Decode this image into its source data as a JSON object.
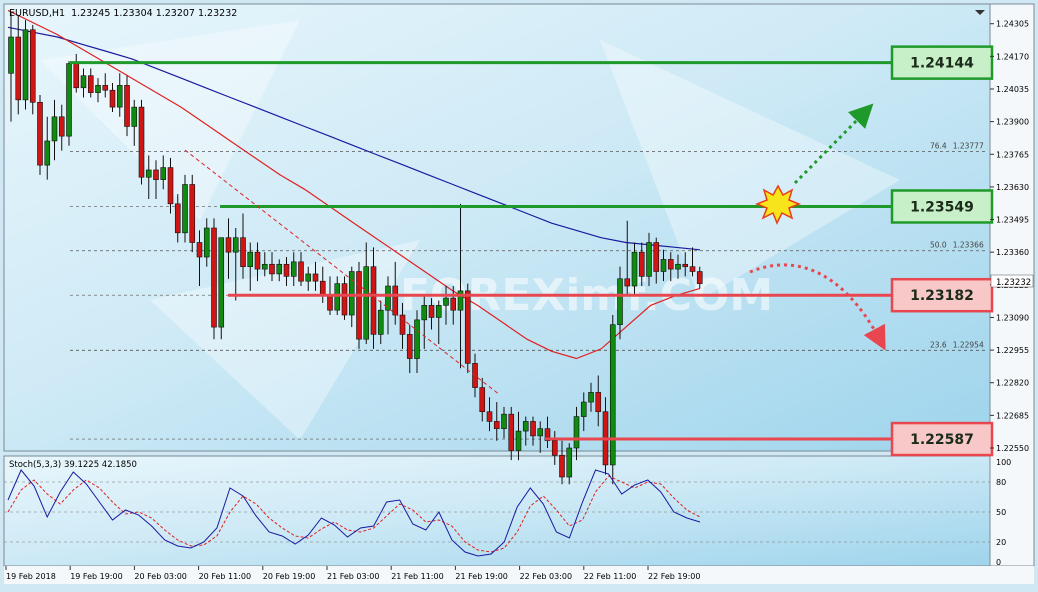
{
  "chart_title": {
    "symbol": "EURUSD,H1",
    "ohlc": "1.23245 1.23304 1.23207 1.23232"
  },
  "watermark": "FOREXimf.COM",
  "price_axis": {
    "ticks": [
      "1.24305",
      "1.24170",
      "1.24035",
      "1.23900",
      "1.23765",
      "1.23630",
      "1.23495",
      "1.23360",
      "1.23225",
      "1.23090",
      "1.22955",
      "1.22820",
      "1.22685",
      "1.22550"
    ],
    "current_price": "1.23232"
  },
  "time_axis": {
    "labels": [
      "19 Feb 2018",
      "19 Feb 19:00",
      "20 Feb 03:00",
      "20 Feb 11:00",
      "20 Feb 19:00",
      "21 Feb 03:00",
      "21 Feb 11:00",
      "21 Feb 19:00",
      "22 Feb 03:00",
      "22 Feb 11:00",
      "22 Feb 19:00"
    ]
  },
  "levels": [
    {
      "value": 1.24144,
      "label": "1.24144",
      "kind": "resistance",
      "color": "#1f9a2a",
      "fill": "#c8f0c8"
    },
    {
      "value": 1.23549,
      "label": "1.23549",
      "kind": "resistance",
      "color": "#1f9a2a",
      "fill": "#c8f0c8"
    },
    {
      "value": 1.23182,
      "label": "1.23182",
      "kind": "support",
      "color": "#e8474f",
      "fill": "#f8c8c8"
    },
    {
      "value": 1.22587,
      "label": "1.22587",
      "kind": "support",
      "color": "#e8474f",
      "fill": "#f8c8c8"
    }
  ],
  "fibonacci": [
    {
      "ratio": "76.4",
      "price": "1.23777"
    },
    {
      "ratio": "50.0",
      "price": "1.23366"
    },
    {
      "ratio": "23.6",
      "price": "1.22954"
    }
  ],
  "stochastic": {
    "title": "Stoch(5,3,3) 39.1225 42.1850",
    "ticks": [
      "100",
      "80",
      "50",
      "20",
      "0"
    ]
  },
  "colors": {
    "bull_candle": "#118a11",
    "bear_candle": "#d01515",
    "ma_fast": "#e02020",
    "ma_slow": "#1a1aa0"
  },
  "chart_data": {
    "type": "candlestick",
    "symbol": "EURUSD",
    "timeframe": "H1",
    "ylim": [
      1.2255,
      1.2437
    ],
    "candles": [
      {
        "o": 1.241,
        "h": 1.2435,
        "l": 1.239,
        "c": 1.2425
      },
      {
        "o": 1.2425,
        "h": 1.2434,
        "l": 1.2393,
        "c": 1.2399
      },
      {
        "o": 1.2399,
        "h": 1.2432,
        "l": 1.2395,
        "c": 1.2428
      },
      {
        "o": 1.2428,
        "h": 1.243,
        "l": 1.2393,
        "c": 1.2398
      },
      {
        "o": 1.2398,
        "h": 1.2401,
        "l": 1.2368,
        "c": 1.2372
      },
      {
        "o": 1.2372,
        "h": 1.2392,
        "l": 1.2366,
        "c": 1.2382
      },
      {
        "o": 1.2382,
        "h": 1.2399,
        "l": 1.2374,
        "c": 1.2392
      },
      {
        "o": 1.2392,
        "h": 1.2397,
        "l": 1.2378,
        "c": 1.2384
      },
      {
        "o": 1.2384,
        "h": 1.2415,
        "l": 1.238,
        "c": 1.2414
      },
      {
        "o": 1.2414,
        "h": 1.2418,
        "l": 1.2402,
        "c": 1.2404
      },
      {
        "o": 1.2404,
        "h": 1.2412,
        "l": 1.24,
        "c": 1.2409
      },
      {
        "o": 1.2409,
        "h": 1.2412,
        "l": 1.24,
        "c": 1.2402
      },
      {
        "o": 1.2402,
        "h": 1.2408,
        "l": 1.2398,
        "c": 1.2405
      },
      {
        "o": 1.2405,
        "h": 1.241,
        "l": 1.24,
        "c": 1.2403
      },
      {
        "o": 1.2403,
        "h": 1.2406,
        "l": 1.2394,
        "c": 1.2396
      },
      {
        "o": 1.2396,
        "h": 1.241,
        "l": 1.2392,
        "c": 1.2405
      },
      {
        "o": 1.2405,
        "h": 1.2409,
        "l": 1.2384,
        "c": 1.2388
      },
      {
        "o": 1.2388,
        "h": 1.2399,
        "l": 1.238,
        "c": 1.2396
      },
      {
        "o": 1.2396,
        "h": 1.2399,
        "l": 1.2364,
        "c": 1.2367
      },
      {
        "o": 1.2367,
        "h": 1.2376,
        "l": 1.2358,
        "c": 1.237
      },
      {
        "o": 1.237,
        "h": 1.2374,
        "l": 1.2358,
        "c": 1.2366
      },
      {
        "o": 1.2366,
        "h": 1.2376,
        "l": 1.2362,
        "c": 1.2371
      },
      {
        "o": 1.2371,
        "h": 1.2375,
        "l": 1.2352,
        "c": 1.2356
      },
      {
        "o": 1.2356,
        "h": 1.236,
        "l": 1.234,
        "c": 1.2344
      },
      {
        "o": 1.2344,
        "h": 1.2368,
        "l": 1.234,
        "c": 1.2364
      },
      {
        "o": 1.2364,
        "h": 1.2368,
        "l": 1.2336,
        "c": 1.234
      },
      {
        "o": 1.234,
        "h": 1.2345,
        "l": 1.2322,
        "c": 1.2334
      },
      {
        "o": 1.2334,
        "h": 1.235,
        "l": 1.233,
        "c": 1.2346
      },
      {
        "o": 1.2346,
        "h": 1.235,
        "l": 1.23,
        "c": 1.2305
      },
      {
        "o": 1.2305,
        "h": 1.2342,
        "l": 1.23,
        "c": 1.2342
      },
      {
        "o": 1.2342,
        "h": 1.235,
        "l": 1.2325,
        "c": 1.2336
      },
      {
        "o": 1.2336,
        "h": 1.2346,
        "l": 1.2316,
        "c": 1.2342
      },
      {
        "o": 1.2342,
        "h": 1.2352,
        "l": 1.2325,
        "c": 1.233
      },
      {
        "o": 1.233,
        "h": 1.234,
        "l": 1.232,
        "c": 1.2336
      },
      {
        "o": 1.2336,
        "h": 1.234,
        "l": 1.2324,
        "c": 1.2329
      },
      {
        "o": 1.2329,
        "h": 1.2336,
        "l": 1.2326,
        "c": 1.2331
      },
      {
        "o": 1.2331,
        "h": 1.2336,
        "l": 1.2324,
        "c": 1.2327
      },
      {
        "o": 1.2327,
        "h": 1.2333,
        "l": 1.2324,
        "c": 1.2331
      },
      {
        "o": 1.2331,
        "h": 1.2334,
        "l": 1.2322,
        "c": 1.2326
      },
      {
        "o": 1.2326,
        "h": 1.2336,
        "l": 1.2322,
        "c": 1.2332
      },
      {
        "o": 1.2332,
        "h": 1.2336,
        "l": 1.2322,
        "c": 1.2324
      },
      {
        "o": 1.2324,
        "h": 1.233,
        "l": 1.232,
        "c": 1.2327
      },
      {
        "o": 1.2327,
        "h": 1.2332,
        "l": 1.232,
        "c": 1.2324
      },
      {
        "o": 1.2324,
        "h": 1.233,
        "l": 1.2315,
        "c": 1.2318
      },
      {
        "o": 1.2318,
        "h": 1.2326,
        "l": 1.231,
        "c": 1.2312
      },
      {
        "o": 1.2312,
        "h": 1.2326,
        "l": 1.231,
        "c": 1.2323
      },
      {
        "o": 1.2323,
        "h": 1.2326,
        "l": 1.2308,
        "c": 1.231
      },
      {
        "o": 1.231,
        "h": 1.233,
        "l": 1.2305,
        "c": 1.2328
      },
      {
        "o": 1.2328,
        "h": 1.2332,
        "l": 1.2296,
        "c": 1.23
      },
      {
        "o": 1.23,
        "h": 1.234,
        "l": 1.2298,
        "c": 1.233
      },
      {
        "o": 1.233,
        "h": 1.2338,
        "l": 1.2296,
        "c": 1.2302
      },
      {
        "o": 1.2302,
        "h": 1.2316,
        "l": 1.2298,
        "c": 1.2312
      },
      {
        "o": 1.2312,
        "h": 1.2326,
        "l": 1.2302,
        "c": 1.2322
      },
      {
        "o": 1.2322,
        "h": 1.2332,
        "l": 1.2306,
        "c": 1.231
      },
      {
        "o": 1.231,
        "h": 1.2315,
        "l": 1.2296,
        "c": 1.2302
      },
      {
        "o": 1.2302,
        "h": 1.2306,
        "l": 1.2286,
        "c": 1.2292
      },
      {
        "o": 1.2292,
        "h": 1.2312,
        "l": 1.2286,
        "c": 1.2308
      },
      {
        "o": 1.2308,
        "h": 1.2318,
        "l": 1.2296,
        "c": 1.2314
      },
      {
        "o": 1.2314,
        "h": 1.2317,
        "l": 1.2304,
        "c": 1.2309
      },
      {
        "o": 1.2309,
        "h": 1.2316,
        "l": 1.2298,
        "c": 1.2314
      },
      {
        "o": 1.2314,
        "h": 1.2322,
        "l": 1.2306,
        "c": 1.2317
      },
      {
        "o": 1.2317,
        "h": 1.2322,
        "l": 1.2306,
        "c": 1.2312
      },
      {
        "o": 1.2312,
        "h": 1.2356,
        "l": 1.2288,
        "c": 1.232
      },
      {
        "o": 1.232,
        "h": 1.2323,
        "l": 1.2286,
        "c": 1.229
      },
      {
        "o": 1.229,
        "h": 1.2294,
        "l": 1.2276,
        "c": 1.228
      },
      {
        "o": 1.228,
        "h": 1.2284,
        "l": 1.2266,
        "c": 1.227
      },
      {
        "o": 1.227,
        "h": 1.2276,
        "l": 1.2262,
        "c": 1.2266
      },
      {
        "o": 1.2266,
        "h": 1.2274,
        "l": 1.2258,
        "c": 1.2263
      },
      {
        "o": 1.2263,
        "h": 1.2272,
        "l": 1.2259,
        "c": 1.2269
      },
      {
        "o": 1.2269,
        "h": 1.2272,
        "l": 1.225,
        "c": 1.2254
      },
      {
        "o": 1.2254,
        "h": 1.227,
        "l": 1.225,
        "c": 1.2262
      },
      {
        "o": 1.2262,
        "h": 1.2268,
        "l": 1.2256,
        "c": 1.2266
      },
      {
        "o": 1.2266,
        "h": 1.2268,
        "l": 1.2256,
        "c": 1.226
      },
      {
        "o": 1.226,
        "h": 1.2266,
        "l": 1.2253,
        "c": 1.2263
      },
      {
        "o": 1.2263,
        "h": 1.2268,
        "l": 1.2255,
        "c": 1.2258
      },
      {
        "o": 1.2258,
        "h": 1.2262,
        "l": 1.2248,
        "c": 1.2252
      },
      {
        "o": 1.2252,
        "h": 1.2258,
        "l": 1.224,
        "c": 1.2243
      },
      {
        "o": 1.2243,
        "h": 1.2257,
        "l": 1.224,
        "c": 1.2255
      },
      {
        "o": 1.2255,
        "h": 1.2272,
        "l": 1.225,
        "c": 1.2268
      },
      {
        "o": 1.2268,
        "h": 1.2278,
        "l": 1.2262,
        "c": 1.2274
      },
      {
        "o": 1.2274,
        "h": 1.2282,
        "l": 1.227,
        "c": 1.2278
      },
      {
        "o": 1.2278,
        "h": 1.2285,
        "l": 1.2264,
        "c": 1.227
      },
      {
        "o": 1.227,
        "h": 1.2276,
        "l": 1.2244,
        "c": 1.2248
      },
      {
        "o": 1.2248,
        "h": 1.231,
        "l": 1.224,
        "c": 1.2306
      },
      {
        "o": 1.2306,
        "h": 1.233,
        "l": 1.23,
        "c": 1.2325
      },
      {
        "o": 1.2325,
        "h": 1.2349,
        "l": 1.2318,
        "c": 1.2322
      },
      {
        "o": 1.2322,
        "h": 1.234,
        "l": 1.2318,
        "c": 1.2336
      },
      {
        "o": 1.2336,
        "h": 1.234,
        "l": 1.2322,
        "c": 1.2326
      },
      {
        "o": 1.2326,
        "h": 1.2344,
        "l": 1.2322,
        "c": 1.234
      },
      {
        "o": 1.234,
        "h": 1.2342,
        "l": 1.2323,
        "c": 1.2328
      },
      {
        "o": 1.2328,
        "h": 1.2337,
        "l": 1.2324,
        "c": 1.2333
      },
      {
        "o": 1.2333,
        "h": 1.2336,
        "l": 1.2324,
        "c": 1.2329
      },
      {
        "o": 1.2329,
        "h": 1.2335,
        "l": 1.2325,
        "c": 1.2331
      },
      {
        "o": 1.2331,
        "h": 1.2336,
        "l": 1.2326,
        "c": 1.233
      },
      {
        "o": 1.233,
        "h": 1.2338,
        "l": 1.2326,
        "c": 1.2328
      },
      {
        "o": 1.2328,
        "h": 1.233,
        "l": 1.2321,
        "c": 1.2323
      }
    ],
    "ma_fast": [
      1.2436,
      1.2431,
      1.2426,
      1.242,
      1.2414,
      1.2408,
      1.2402,
      1.2396,
      1.2389,
      1.2382,
      1.2375,
      1.2368,
      1.2362,
      1.2355,
      1.2348,
      1.2341,
      1.2334,
      1.2327,
      1.232,
      1.2314,
      1.2307,
      1.23,
      1.2295,
      1.2292,
      1.2296,
      1.2305,
      1.2314,
      1.2318,
      1.2321
    ],
    "ma_slow": [
      1.2429,
      1.2427,
      1.2425,
      1.2422,
      1.2419,
      1.2416,
      1.2412,
      1.2408,
      1.2404,
      1.24,
      1.2396,
      1.2392,
      1.2388,
      1.2384,
      1.238,
      1.2376,
      1.2372,
      1.2368,
      1.2364,
      1.236,
      1.2356,
      1.2352,
      1.2348,
      1.2345,
      1.2342,
      1.234,
      1.2339,
      1.2338,
      1.2337
    ],
    "stoch_main": [
      62,
      92,
      76,
      45,
      70,
      90,
      78,
      60,
      42,
      52,
      47,
      36,
      22,
      16,
      14,
      20,
      34,
      74,
      66,
      46,
      30,
      26,
      18,
      27,
      44,
      37,
      25,
      34,
      36,
      60,
      62,
      38,
      32,
      50,
      22,
      10,
      6,
      8,
      20,
      55,
      74,
      58,
      30,
      24,
      60,
      92,
      88,
      68,
      77,
      82,
      70,
      50,
      44,
      40
    ],
    "stoch_signal": [
      50,
      72,
      82,
      68,
      58,
      72,
      82,
      74,
      60,
      48,
      50,
      44,
      32,
      22,
      16,
      17,
      26,
      50,
      66,
      58,
      44,
      34,
      26,
      24,
      33,
      40,
      32,
      30,
      34,
      46,
      58,
      52,
      40,
      42,
      36,
      20,
      12,
      10,
      14,
      30,
      56,
      66,
      52,
      36,
      42,
      70,
      86,
      80,
      74,
      80,
      78,
      64,
      52,
      45
    ]
  }
}
